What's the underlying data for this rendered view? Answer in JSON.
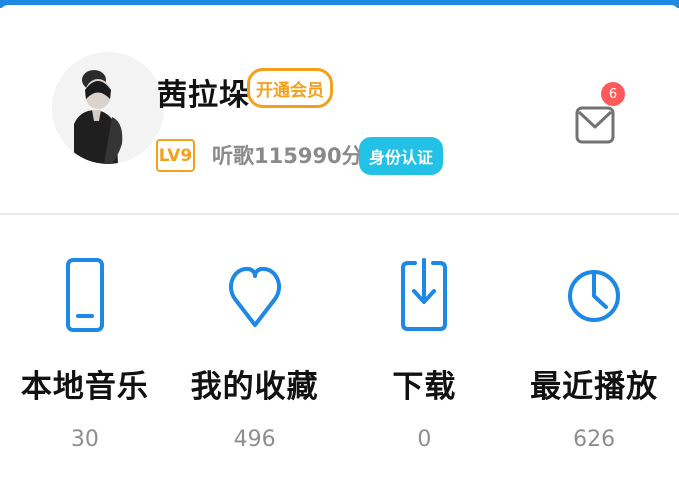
{
  "profile": {
    "name": "茜拉垛",
    "vip_button": "开通会员",
    "level": "LV9",
    "listen_time": "听歌115990分钟",
    "verify_button": "身份认证",
    "message_count": "6"
  },
  "shortcuts": [
    {
      "label": "本地音乐",
      "count": "30",
      "icon": "phone-icon"
    },
    {
      "label": "我的收藏",
      "count": "496",
      "icon": "heart-icon"
    },
    {
      "label": "下载",
      "count": "0",
      "icon": "download-icon"
    },
    {
      "label": "最近播放",
      "count": "626",
      "icon": "clock-icon"
    }
  ],
  "colors": {
    "accent": "#1e88e5",
    "vip": "#f3a11c",
    "verify": "#22c1e5",
    "badge": "#ff5a5a"
  }
}
